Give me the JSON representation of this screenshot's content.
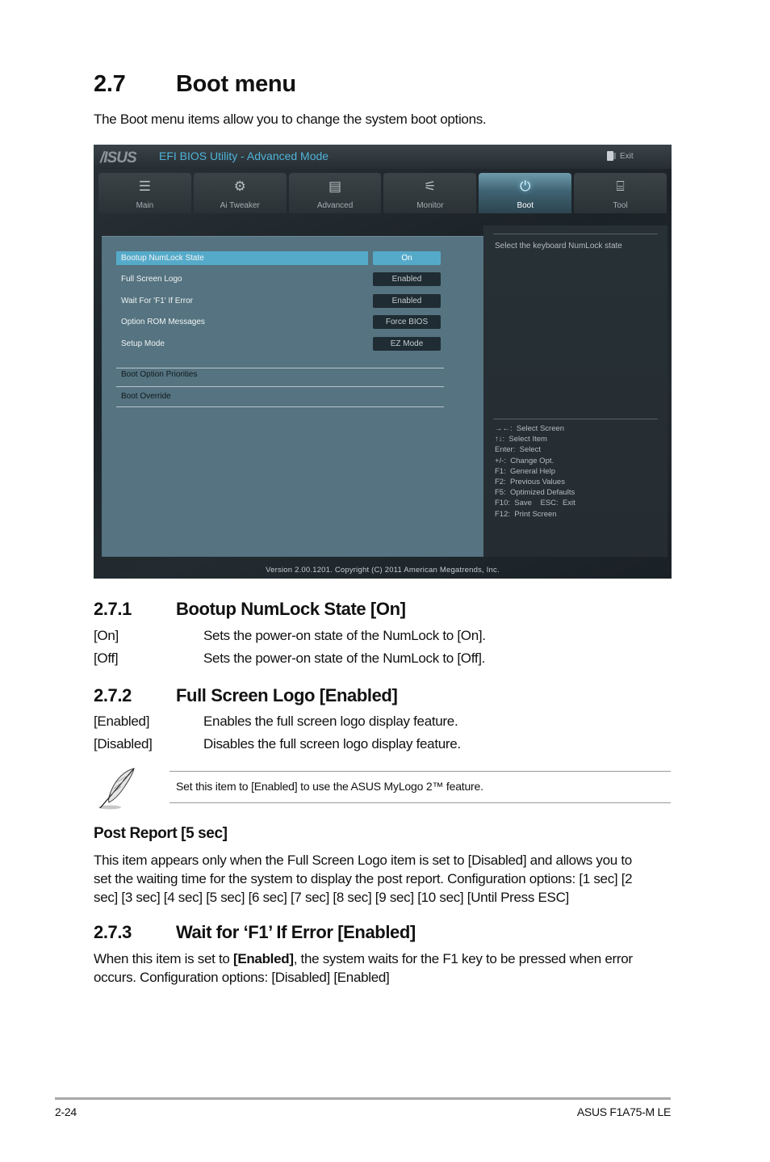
{
  "page": {
    "section_number": "2.7",
    "section_title": "Boot menu",
    "intro": "The Boot menu items allow you to change the system boot options."
  },
  "bios": {
    "logo": "/ISUS",
    "title": "EFI BIOS Utility - Advanced Mode",
    "exit_label": "Exit",
    "tabs": [
      {
        "label": "Main",
        "icon": "list-icon",
        "glyph": "☰"
      },
      {
        "label": "Ai  Tweaker",
        "icon": "tweaker-icon",
        "glyph": "⚙"
      },
      {
        "label": "Advanced",
        "icon": "advanced-icon",
        "glyph": "▤"
      },
      {
        "label": "Monitor",
        "icon": "monitor-icon",
        "glyph": "⚟"
      },
      {
        "label": "Boot",
        "icon": "power-icon",
        "glyph": "⏻"
      },
      {
        "label": "Tool",
        "icon": "tool-icon",
        "glyph": "⌸"
      }
    ],
    "active_tab": "Boot",
    "settings": [
      {
        "label": "Bootup NumLock State",
        "value": "On"
      },
      {
        "label": "Full Screen Logo",
        "value": "Enabled"
      },
      {
        "label": "Wait For 'F1' If Error",
        "value": "Enabled"
      },
      {
        "label": "Option ROM Messages",
        "value": "Force BIOS"
      },
      {
        "label": "Setup Mode",
        "value": "EZ Mode"
      }
    ],
    "submenus": [
      "Boot Option Priorities",
      "Boot Override"
    ],
    "help_text": "Select the keyboard NumLock state",
    "key_help": [
      "→←:  Select Screen",
      "↑↓:  Select Item",
      "Enter:  Select",
      "+/-:  Change Opt.",
      "F1:  General Help",
      "F2:  Previous Values",
      "F5:  Optimized Defaults",
      "F10:  Save    ESC:  Exit",
      "F12:  Print Screen"
    ],
    "version": "Version  2.00.1201.  Copyright  (C)  2011  American  Megatrends,  Inc."
  },
  "s271": {
    "number": "2.7.1",
    "title": "Bootup NumLock State [On]",
    "options": [
      {
        "opt": "[On]",
        "desc": "Sets the power-on state of the NumLock to [On]."
      },
      {
        "opt": "[Off]",
        "desc": "Sets the power-on state of the NumLock to [Off]."
      }
    ]
  },
  "s272": {
    "number": "2.7.2",
    "title": "Full Screen Logo [Enabled]",
    "options": [
      {
        "opt": "[Enabled]",
        "desc": "Enables the full screen logo display feature."
      },
      {
        "opt": "[Disabled]",
        "desc": "Disables the full screen logo display feature."
      }
    ],
    "note": "Set this item to [Enabled] to use the ASUS MyLogo 2™ feature."
  },
  "post_report": {
    "title": "Post Report [5 sec]",
    "body_lines": [
      "This item appears only when the Full Screen Logo item is set to [Disabled] and allows you to",
      "set the waiting time for the system to display the post report. Configuration options: [1 sec] [2",
      "sec] [3 sec] [4 sec] [5 sec] [6 sec] [7 sec] [8 sec] [9 sec] [10 sec] [Until Press ESC]"
    ]
  },
  "s273": {
    "number": "2.7.3",
    "title": "Wait for ‘F1’ If Error [Enabled]",
    "body_pre": "When this item is set to ",
    "body_bold": "[Enabled]",
    "body_post": ", the system waits for the F1 key to be pressed when error",
    "body_line2": "occurs. Configuration options: [Disabled] [Enabled]"
  },
  "footer": {
    "page_number": "2-24",
    "product": "ASUS F1A75-M LE"
  }
}
